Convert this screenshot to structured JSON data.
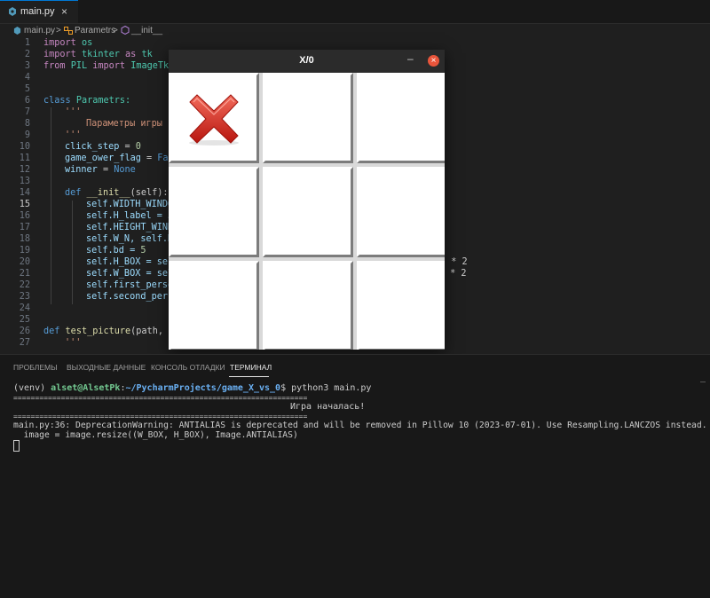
{
  "tab": {
    "name": "main.py",
    "close": "×"
  },
  "breadcrumb": {
    "file": "main.py",
    "sep1": ">",
    "class": "Parametrs",
    "sep2": ">",
    "method": "__init__"
  },
  "editor": {
    "current_line": 15,
    "lines": [
      {
        "n": "1"
      },
      {
        "n": "2"
      },
      {
        "n": "3"
      },
      {
        "n": "4"
      },
      {
        "n": "5"
      },
      {
        "n": "6"
      },
      {
        "n": "7"
      },
      {
        "n": "8"
      },
      {
        "n": "9"
      },
      {
        "n": "10"
      },
      {
        "n": "11"
      },
      {
        "n": "12"
      },
      {
        "n": "13"
      },
      {
        "n": "14"
      },
      {
        "n": "15"
      },
      {
        "n": "16"
      },
      {
        "n": "17"
      },
      {
        "n": "18"
      },
      {
        "n": "19"
      },
      {
        "n": "20"
      },
      {
        "n": "21"
      },
      {
        "n": "22"
      },
      {
        "n": "23"
      },
      {
        "n": "24"
      },
      {
        "n": "25"
      },
      {
        "n": "26"
      },
      {
        "n": "27"
      }
    ],
    "code": {
      "l1a": "import",
      "l1b": "os",
      "l2a": "import",
      "l2b": "tkinter",
      "l2c": "as",
      "l2d": "tk",
      "l3a": "from",
      "l3b": "PIL",
      "l3c": "import",
      "l3d": "ImageTk,",
      "l6a": "class",
      "l6b": "Parametrs:",
      "l7": "'''",
      "l8": "Параметры игры",
      "l9": "'''",
      "l10a": "click_step",
      "l10b": " = ",
      "l10c": "0",
      "l11a": "game_ower_flag",
      "l11b": " = ",
      "l11c": "Fal",
      "l12a": "winner",
      "l12b": " = ",
      "l12c": "None",
      "l14a": "def",
      "l14b": "__init__",
      "l14c": "(self):",
      "l15": "self.WIDTH_WINDO",
      "l16": "self.H_label = 5",
      "l17": "self.HEIGHT_WIND",
      "l18": "self.W_N, self.H",
      "l19a": "self.bd = ",
      "l19b": "5",
      "l20a": "self.H_BOX = sel",
      "l20b": ") * 2",
      "l21a": "self.W_BOX = sel",
      "l21b": " * 2",
      "l22": "self.first_perso",
      "l23": "self.second_pers",
      "l26a": "def",
      "l26b": "test_picture",
      "l26c": "(path, W",
      "l27": "'''"
    }
  },
  "game_window": {
    "title": "X/0",
    "minimize": "–",
    "close": "×",
    "cells": [
      "X",
      "",
      "",
      "",
      "",
      "",
      "",
      "",
      ""
    ]
  },
  "panel": {
    "tabs": [
      "ПРОБЛЕМЫ",
      "ВЫХОДНЫЕ ДАННЫЕ",
      "КОНСОЛЬ ОТЛАДКИ",
      "ТЕРМИНАЛ"
    ],
    "active_tab": "ТЕРМИНАЛ",
    "terminal": {
      "prompt_venv": "(venv) ",
      "prompt_user": "alset@AlsetPk",
      "prompt_sep": ":",
      "prompt_path": "~/PycharmProjects/game_X_vs_0",
      "prompt_end": "$ ",
      "command": "python3 main.py",
      "rule1": "====================================================================",
      "message": "Игра началась!",
      "rule2": "====================================================================",
      "warning1": "main.py:36: DeprecationWarning: ANTIALIAS is deprecated and will be removed in Pillow 10 (2023-07-01). Use Resampling.LANCZOS instead.",
      "warning2": "  image = image.resize((W_BOX, H_BOX), Image.ANTIALIAS)"
    }
  },
  "colors": {
    "accent": "#0078d4",
    "close_red": "#e9553b",
    "x_red": "#d8261b"
  }
}
